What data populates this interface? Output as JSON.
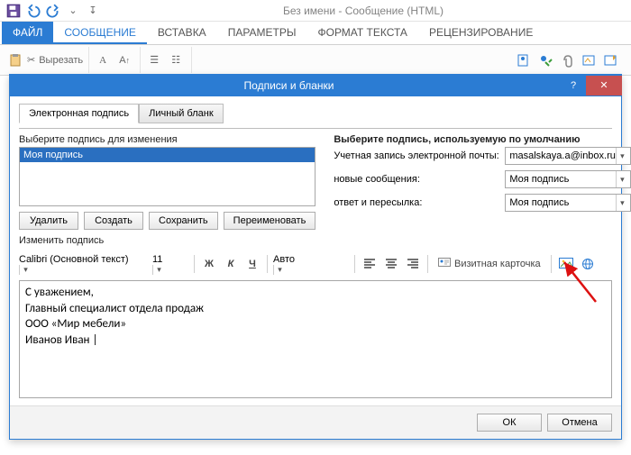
{
  "window": {
    "title": "Без имени - Сообщение (HTML)"
  },
  "ribbon": {
    "tabs": {
      "file": "ФАЙЛ",
      "message": "СООБЩЕНИЕ",
      "insert": "ВСТАВКА",
      "options": "ПАРАМЕТРЫ",
      "format": "ФОРМАТ ТЕКСТА",
      "review": "РЕЦЕНЗИРОВАНИЕ"
    },
    "clipboard": {
      "cut": "Вырезать"
    }
  },
  "dialog": {
    "title": "Подписи и бланки",
    "tabs": {
      "esig": "Электронная подпись",
      "blank": "Личный бланк"
    },
    "left": {
      "label": "Выберите подпись для изменения",
      "list": {
        "item0": "Моя подпись"
      },
      "buttons": {
        "del": "Удалить",
        "create": "Создать",
        "save": "Сохранить",
        "rename": "Переименовать"
      }
    },
    "right": {
      "label": "Выберите подпись, используемую по умолчанию",
      "account_lbl": "Учетная запись электронной почты:",
      "account_val": "masalskaya.a@inbox.ru",
      "new_lbl": "новые сообщения:",
      "new_val": "Моя подпись",
      "reply_lbl": "ответ и пересылка:",
      "reply_val": "Моя подпись"
    },
    "edit": {
      "label": "Изменить подпись",
      "font": "Calibri (Основной текст)",
      "size": "11",
      "color": "Авто",
      "bizcard": "Визитная карточка",
      "text": "С уважением,\nГлавный специалист отдела продаж\nООО «Мир мебели»\nИванов Иван |"
    },
    "footer": {
      "ok": "ОК",
      "cancel": "Отмена"
    }
  },
  "icons": {
    "bold": "Ж",
    "italic": "К",
    "underline": "Ч"
  }
}
